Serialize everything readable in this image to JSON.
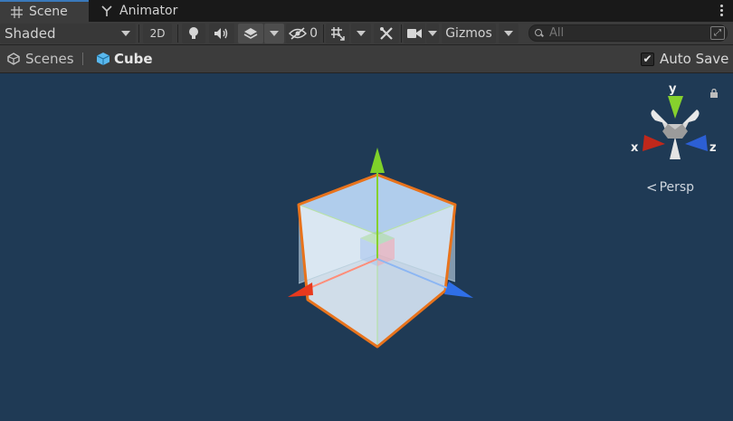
{
  "tabs": [
    {
      "label": "Scene",
      "icon": "grid-icon",
      "active": true
    },
    {
      "label": "Animator",
      "icon": "animator-icon",
      "active": false
    }
  ],
  "toolbar": {
    "shading_mode": "Shaded",
    "two_d_label": "2D",
    "hidden_count": "0",
    "gizmos_label": "Gizmos",
    "search_placeholder": "All"
  },
  "breadcrumbs": {
    "scenes_label": "Scenes",
    "current_label": "Cube"
  },
  "autosave": {
    "label": "Auto Save",
    "checked": true
  },
  "viewport": {
    "projection_label": "Persp",
    "axis_labels": {
      "x": "x",
      "y": "y",
      "z": "z"
    }
  },
  "colors": {
    "viewport_bg": "#1f3a55",
    "selection_outline": "#e8731c",
    "x_axis": "#e8391d",
    "y_axis": "#86d12d",
    "z_axis": "#2f6fe8",
    "tab_accent": "#3a79bb"
  }
}
